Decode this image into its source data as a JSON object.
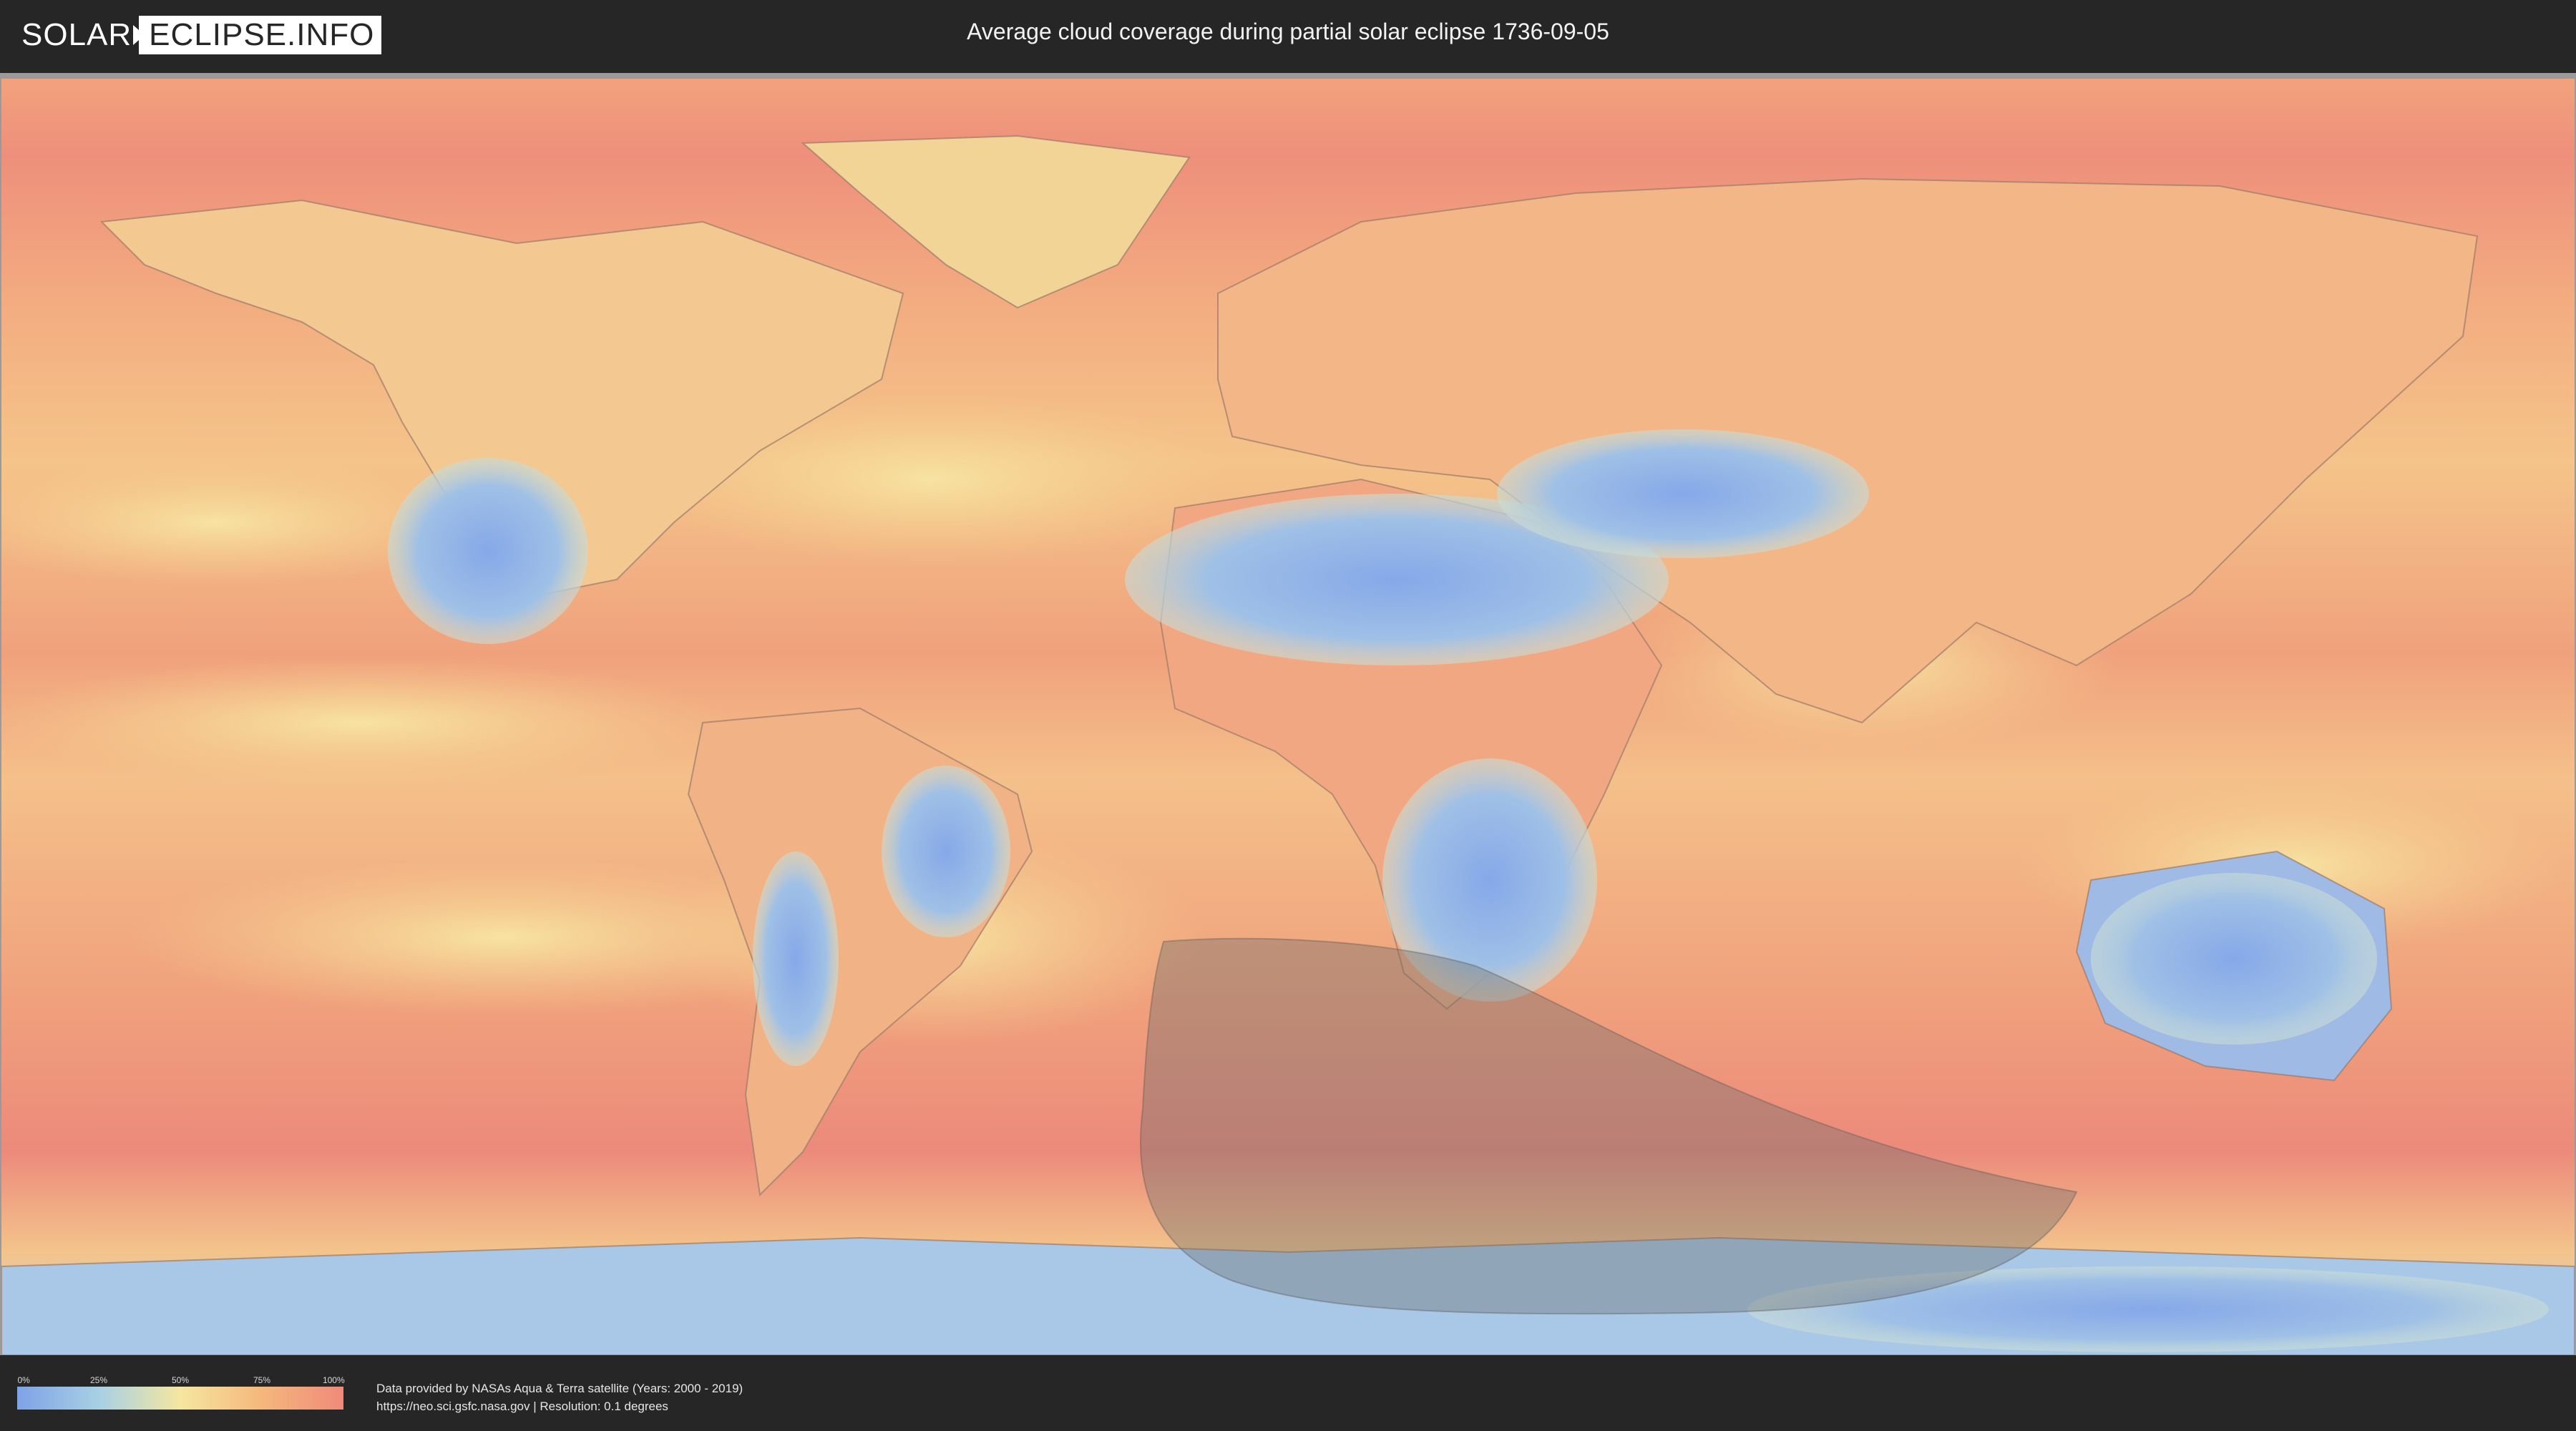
{
  "header": {
    "logo_part1": "SOLAR",
    "logo_part2": "ECLIPSE.INFO",
    "title": "Average cloud coverage during partial solar eclipse 1736-09-05"
  },
  "legend": {
    "ticks": [
      "0%",
      "25%",
      "50%",
      "75%",
      "100%"
    ],
    "colors": [
      "#7ea2e6",
      "#a8d0e4",
      "#f5e6a0",
      "#f5b77c",
      "#ef8a7a"
    ]
  },
  "credits": {
    "line1": "Data provided by NASAs Aqua & Terra satellite (Years: 2000 - 2019)",
    "line2": "https://neo.sci.gsfc.nasa.gov | Resolution: 0.1 degrees"
  },
  "map": {
    "projection": "equirectangular",
    "ocean_color": "#f1a47a",
    "clear_color": "#8fb1e8",
    "eclipse_shadow_color": "#6b6b6b"
  }
}
